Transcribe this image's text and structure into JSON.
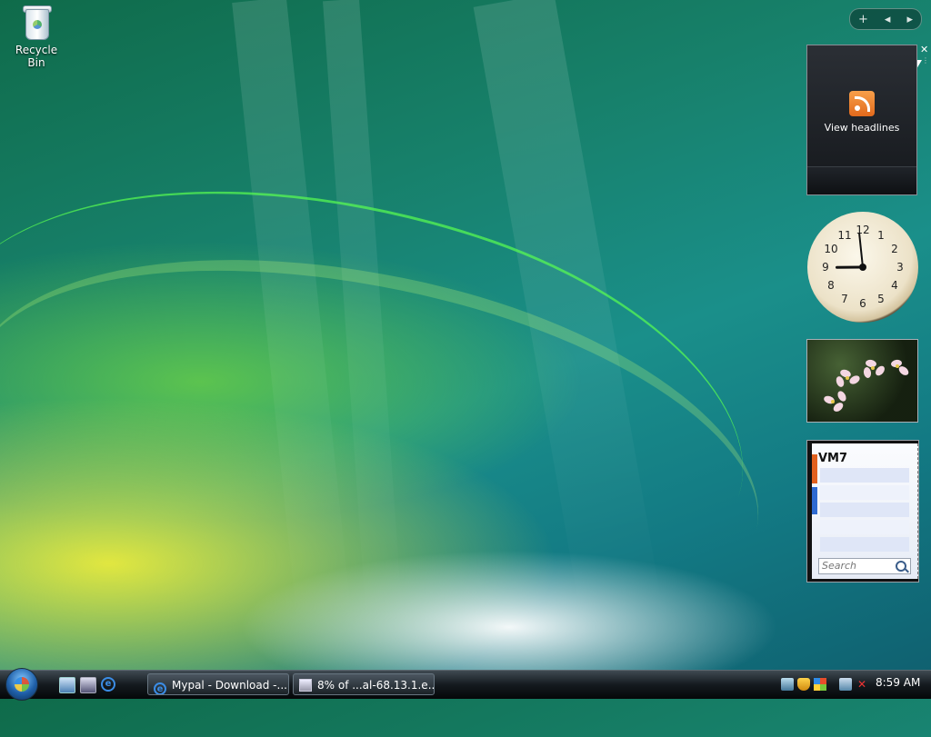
{
  "desktop": {
    "icons": [
      {
        "label": "Recycle Bin",
        "icon": "recycle-bin-icon"
      }
    ]
  },
  "sidebar": {
    "controls": {
      "add": "+",
      "prev": "◂",
      "next": "▸"
    },
    "close": "✕",
    "feed": {
      "label": "View headlines",
      "icon": "rss-icon"
    },
    "clock": {
      "numbers": [
        "12",
        "1",
        "2",
        "3",
        "4",
        "5",
        "6",
        "7",
        "8",
        "9",
        "10",
        "11"
      ],
      "time": "8:59"
    },
    "notes": {
      "title": "VM7",
      "search_placeholder": "Search"
    }
  },
  "taskbar": {
    "tasks": [
      {
        "label": "Mypal - Download -..."
      },
      {
        "label": "8% of ...al-68.13.1.e..."
      }
    ],
    "clock": "8:59 AM"
  },
  "colors": {
    "rss": "#e1691c",
    "tab_orange": "#e2611e",
    "tab_blue": "#2e6ad1"
  }
}
